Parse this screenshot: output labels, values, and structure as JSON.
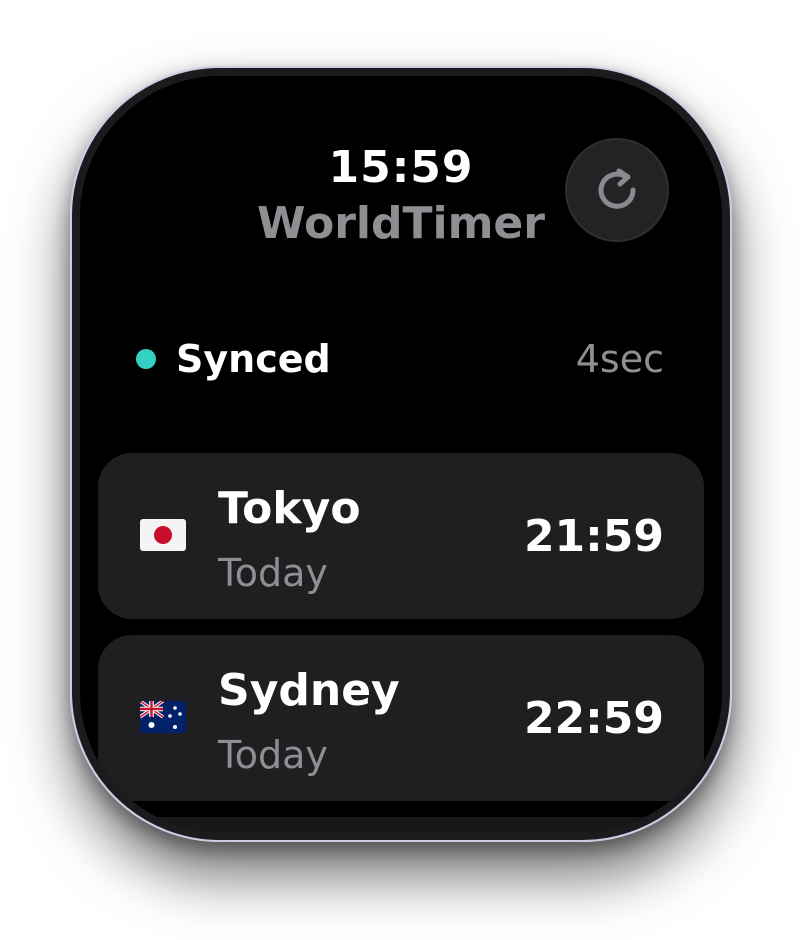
{
  "header": {
    "time": "15:59",
    "app_title": "WorldTimer",
    "refresh_icon": "refresh-icon"
  },
  "status": {
    "label": "Synced",
    "age": "4sec",
    "dot_color": "#35d0c4"
  },
  "cities": [
    {
      "name": "Tokyo",
      "day": "Today",
      "time": "21:59",
      "flag_icon": "japan-flag-icon"
    },
    {
      "name": "Sydney",
      "day": "Today",
      "time": "22:59",
      "flag_icon": "australia-flag-icon"
    }
  ],
  "colors": {
    "background": "#000000",
    "card": "#1f1f21",
    "secondary_text": "#8e8e93",
    "accent": "#35d0c4"
  }
}
